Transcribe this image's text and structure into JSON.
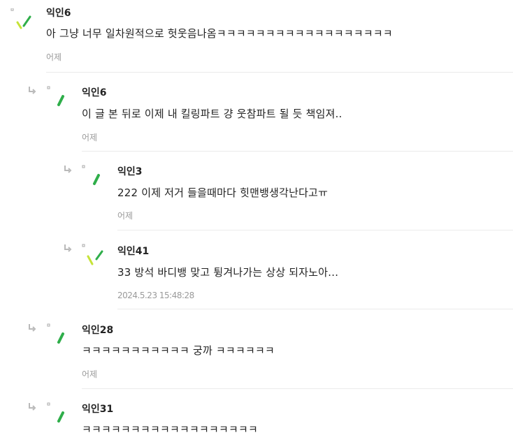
{
  "colors": {
    "avatar_green": "#2fae4a",
    "avatar_lime": "#c6e337",
    "meta_gray": "#9a9a9a",
    "reply_arrow_gray": "#b9b9b9"
  },
  "comments": [
    {
      "author": "익인6",
      "text": "아 그냥 너무 일차원적으로 헛웃음나옴ㅋㅋㅋㅋㅋㅋㅋㅋㅋㅋㅋㅋㅋㅋㅋㅋㅋㅋ",
      "time": "어제",
      "avatar_icon": "tick-avatar-icon"
    },
    {
      "author": "익인6",
      "text": "이 글 본 뒤로 이제 내 킬링파트 걍 웃참파트 될 듯 책임져..",
      "time": "어제",
      "avatar_icon": "dash-avatar-icon"
    },
    {
      "author": "익인3",
      "text": "222 이제 저거 들을때마다 힛맨뱅생각난다고ㅠ",
      "time": "어제",
      "avatar_icon": "dash-avatar-icon"
    },
    {
      "author": "익인41",
      "text": "33 방석 바디뱅 맞고 튕겨나가는 상상 되자노아...",
      "time": "2024.5.23 15:48:28",
      "avatar_icon": "tick-avatar-icon"
    },
    {
      "author": "익인28",
      "text": "ㅋㅋㅋㅋㅋㅋㅋㅋㅋㅋㅋ 궁까 ㅋㅋㅋㅋㅋㅋ",
      "time": "어제",
      "avatar_icon": "dash-avatar-icon"
    },
    {
      "author": "익인31",
      "text": "ㅋㅋㅋㅋㅋㅋㅋㅋㅋㅋㅋㅋㅋㅋㅋㅋㅋㅋ",
      "time": "",
      "avatar_icon": "dash-avatar-icon"
    }
  ]
}
